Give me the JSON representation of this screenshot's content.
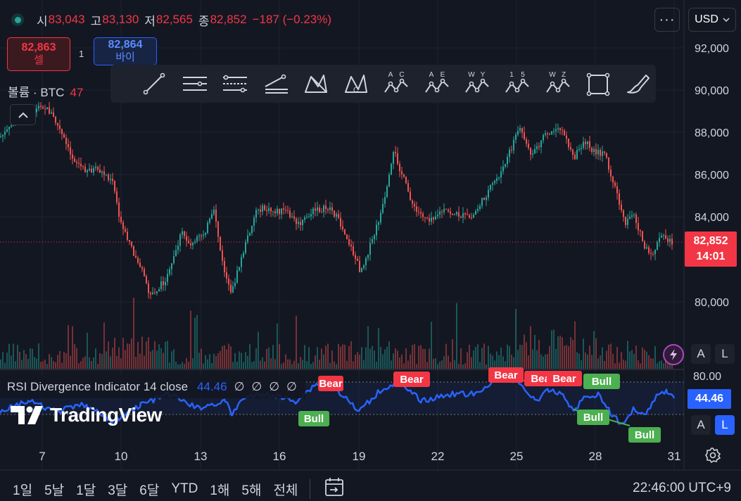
{
  "header": {
    "open_label": "시",
    "open_value": "83,043",
    "high_label": "고",
    "high_value": "83,130",
    "low_label": "저",
    "low_value": "82,565",
    "close_label": "종",
    "close_value": "82,852",
    "change": "−187 (−0.23%)",
    "menu_label": "···",
    "currency_label": "USD"
  },
  "trade": {
    "sell_price": "82,863",
    "sell_label": "셀",
    "spread": "1",
    "buy_price": "82,864",
    "buy_label": "바이"
  },
  "volume_legend": {
    "label": "볼륨 · BTC",
    "value": "47"
  },
  "price_axis": {
    "labels": [
      "92,000",
      "90,000",
      "88,000",
      "86,000",
      "84,000",
      "80,000"
    ]
  },
  "current_price": {
    "price": "82,852",
    "countdown": "14:01"
  },
  "rsi": {
    "legend_title": "RSI Divergence Indicator 14 close",
    "value": "44.46",
    "na_values": [
      "∅",
      "∅",
      "∅",
      "∅"
    ],
    "upper_label": "80.00",
    "signals": [
      {
        "label": "Bear",
        "type": "bear"
      },
      {
        "label": "Bear",
        "type": "bear"
      },
      {
        "label": "Bear",
        "type": "bear"
      },
      {
        "label": "Bear",
        "type": "bear"
      },
      {
        "label": "Bear",
        "type": "bear"
      },
      {
        "label": "Bull",
        "type": "bull"
      },
      {
        "label": "Bull",
        "type": "bull"
      },
      {
        "label": "Bull",
        "type": "bull"
      },
      {
        "label": "Bull",
        "type": "bull"
      }
    ]
  },
  "scale_buttons": {
    "auto": "A",
    "log": "L"
  },
  "time_axis": {
    "labels": [
      "7",
      "10",
      "13",
      "16",
      "19",
      "22",
      "25",
      "28",
      "31"
    ]
  },
  "watermark": "TradingView",
  "drawing_tools": [
    {
      "name": "trend-line-icon",
      "sub": ""
    },
    {
      "name": "parallel-channel-icon",
      "sub": ""
    },
    {
      "name": "fib-retracement-icon",
      "sub": ""
    },
    {
      "name": "pitchfork-icon",
      "sub": ""
    },
    {
      "name": "xabcd-pattern-icon",
      "sub": ""
    },
    {
      "name": "cypher-pattern-icon",
      "sub": ""
    },
    {
      "name": "abcd-pattern-icon",
      "sub": "A C"
    },
    {
      "name": "triangle-pattern-icon",
      "sub": "A E"
    },
    {
      "name": "three-drives-icon",
      "sub": "W Y"
    },
    {
      "name": "elliott-impulse-icon",
      "sub": "1 5"
    },
    {
      "name": "elliott-wxy-icon",
      "sub": "W Z"
    },
    {
      "name": "rectangle-icon",
      "sub": ""
    },
    {
      "name": "brush-icon",
      "sub": ""
    }
  ],
  "bottom_bar": {
    "ranges": [
      "1일",
      "5날",
      "1달",
      "3달",
      "6달",
      "YTD",
      "1해",
      "5해",
      "전체"
    ],
    "clock": "22:46:00 UTC+9"
  },
  "colors": {
    "up": "#26a69a",
    "down": "#ef5350",
    "rsi_line": "#2962ff",
    "bear": "#f23645",
    "bull": "#4caf50",
    "background": "#131722"
  }
}
